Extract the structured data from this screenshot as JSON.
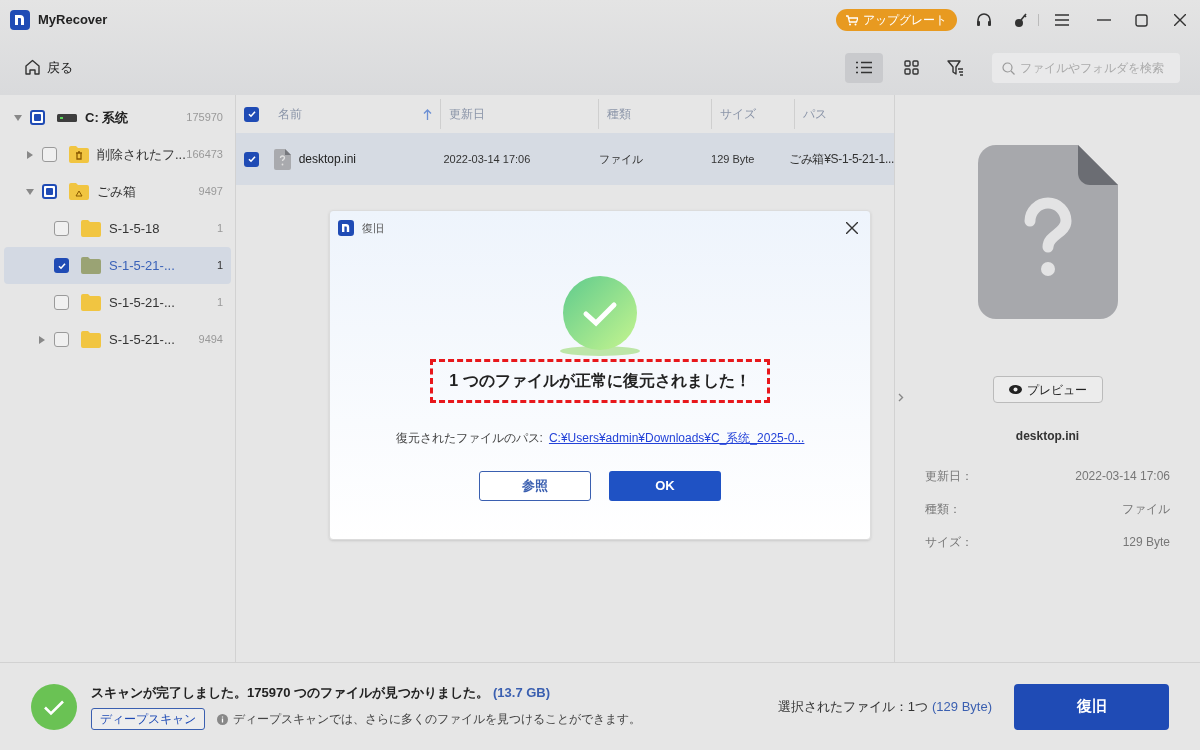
{
  "app": {
    "title": "MyRecover",
    "upgrade": "アップグレート"
  },
  "toolbar": {
    "back": "戻る",
    "views": [
      {
        "kind": "list",
        "selected": true
      },
      {
        "kind": "grid",
        "selected": false
      }
    ],
    "search": {
      "placeholder": "ファイルやフォルダを検索"
    }
  },
  "tree": [
    {
      "name": "C: 系统",
      "count": "175970",
      "kind": "drive",
      "checked": false,
      "partial": true,
      "selected": false,
      "expanded": true,
      "children": [
        {
          "name": "削除されたフ...",
          "count": "166473",
          "kind": "trash",
          "checked": false,
          "partial": false,
          "selected": false,
          "expanded": false
        },
        {
          "name": "ごみ箱",
          "count": "9497",
          "kind": "recycle",
          "checked": false,
          "partial": true,
          "selected": false,
          "expanded": true,
          "children": [
            {
              "name": "S-1-5-18",
              "count": "1",
              "kind": "folder",
              "checked": false,
              "selected": false
            },
            {
              "name": "S-1-5-21-...",
              "count": "1",
              "kind": "folder",
              "checked": true,
              "selected": true
            },
            {
              "name": "S-1-5-21-...",
              "count": "1",
              "kind": "folder",
              "checked": false,
              "selected": false
            },
            {
              "name": "S-1-5-21-...",
              "count": "9494",
              "kind": "folder",
              "checked": false,
              "selected": false,
              "expanded": false
            }
          ]
        }
      ]
    }
  ],
  "table": {
    "all_checked": true,
    "columns": [
      "名前",
      "更新日",
      "種類",
      "サイズ",
      "パス"
    ],
    "rows": [
      {
        "checked": true,
        "selected": true,
        "name": "desktop.ini",
        "modified": "2022-03-14 17:06",
        "type": "ファイル",
        "size": "129 Byte",
        "path": "ごみ箱¥S-1-5-21-1..."
      }
    ]
  },
  "preview": {
    "button": "プレビュー",
    "filename": "desktop.ini",
    "details": [
      {
        "label": "更新日：",
        "value": "2022-03-14 17:06"
      },
      {
        "label": "種類：",
        "value": "ファイル"
      },
      {
        "label": "サイズ：",
        "value": "129 Byte"
      }
    ]
  },
  "dialog": {
    "title": "復旧",
    "message": "1 つのファイルが正常に復元されました！",
    "path_label": "復元されたファイルのパス:",
    "path": "C:¥Users¥admin¥Downloads¥C_系统_2025-0...",
    "buttons": [
      {
        "label": "参照",
        "primary": false
      },
      {
        "label": "OK",
        "primary": true
      }
    ]
  },
  "status": {
    "message": "スキャンが完了しました。175970 つのファイルが見つかりました。",
    "total": "(13.7 GB)",
    "deep_scan": "ディープスキャン",
    "hint": "ディープスキャンでは、さらに多くのファイルを見つけることができます。",
    "selected_label": "選択されたファイル：1つ",
    "selected_size": "(129 Byte)",
    "recover": "復旧"
  }
}
